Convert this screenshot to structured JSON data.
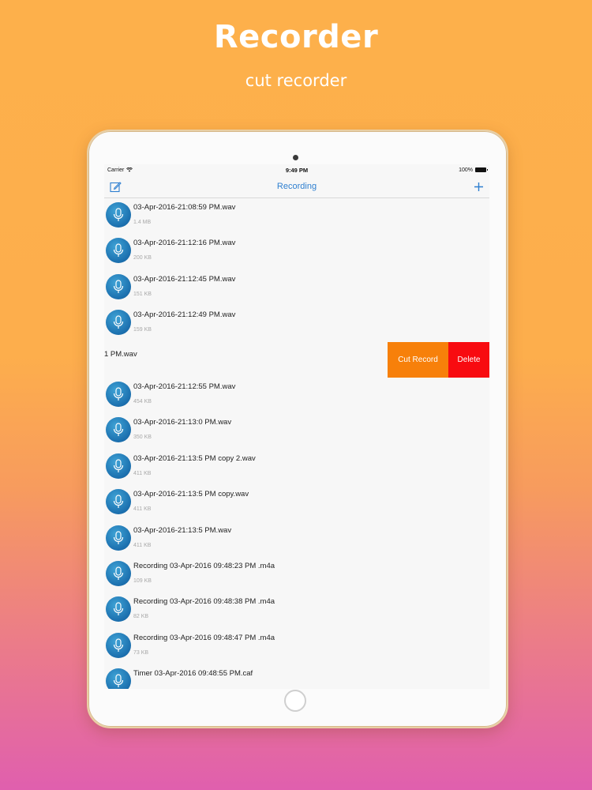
{
  "header": {
    "title": "Recorder",
    "subtitle": "cut recorder"
  },
  "status_bar": {
    "carrier": "Carrier",
    "time": "9:49 PM",
    "battery": "100%"
  },
  "nav": {
    "title": "Recording",
    "edit_icon": "compose-icon",
    "add_icon": "plus-icon"
  },
  "colors": {
    "accent": "#2e7fd0",
    "cut": "#F7800A",
    "delete": "#F80B10"
  },
  "recordings": [
    {
      "name": "03-Apr-2016-21:08:59 PM.wav",
      "size": "1.4 MB"
    },
    {
      "name": "03-Apr-2016-21:12:16 PM.wav",
      "size": "200 KB"
    },
    {
      "name": "03-Apr-2016-21:12:45 PM.wav",
      "size": "151 KB"
    },
    {
      "name": "03-Apr-2016-21:12:49 PM.wav",
      "size": "159 KB"
    }
  ],
  "swiped_row": {
    "visible_name": "1 PM.wav",
    "cut_label": "Cut Record",
    "delete_label": "Delete"
  },
  "recordings_after": [
    {
      "name": "03-Apr-2016-21:12:55 PM.wav",
      "size": "454 KB"
    },
    {
      "name": "03-Apr-2016-21:13:0 PM.wav",
      "size": "350 KB"
    },
    {
      "name": "03-Apr-2016-21:13:5 PM copy 2.wav",
      "size": "411 KB"
    },
    {
      "name": "03-Apr-2016-21:13:5 PM copy.wav",
      "size": "411 KB"
    },
    {
      "name": "03-Apr-2016-21:13:5 PM.wav",
      "size": "411 KB"
    },
    {
      "name": "Recording 03-Apr-2016 09:48:23 PM .m4a",
      "size": "109 KB"
    },
    {
      "name": "Recording 03-Apr-2016 09:48:38 PM .m4a",
      "size": "82 KB"
    },
    {
      "name": "Recording 03-Apr-2016 09:48:47 PM .m4a",
      "size": "73 KB"
    },
    {
      "name": "Timer 03-Apr-2016 09:48:55 PM.caf",
      "size": ""
    }
  ]
}
